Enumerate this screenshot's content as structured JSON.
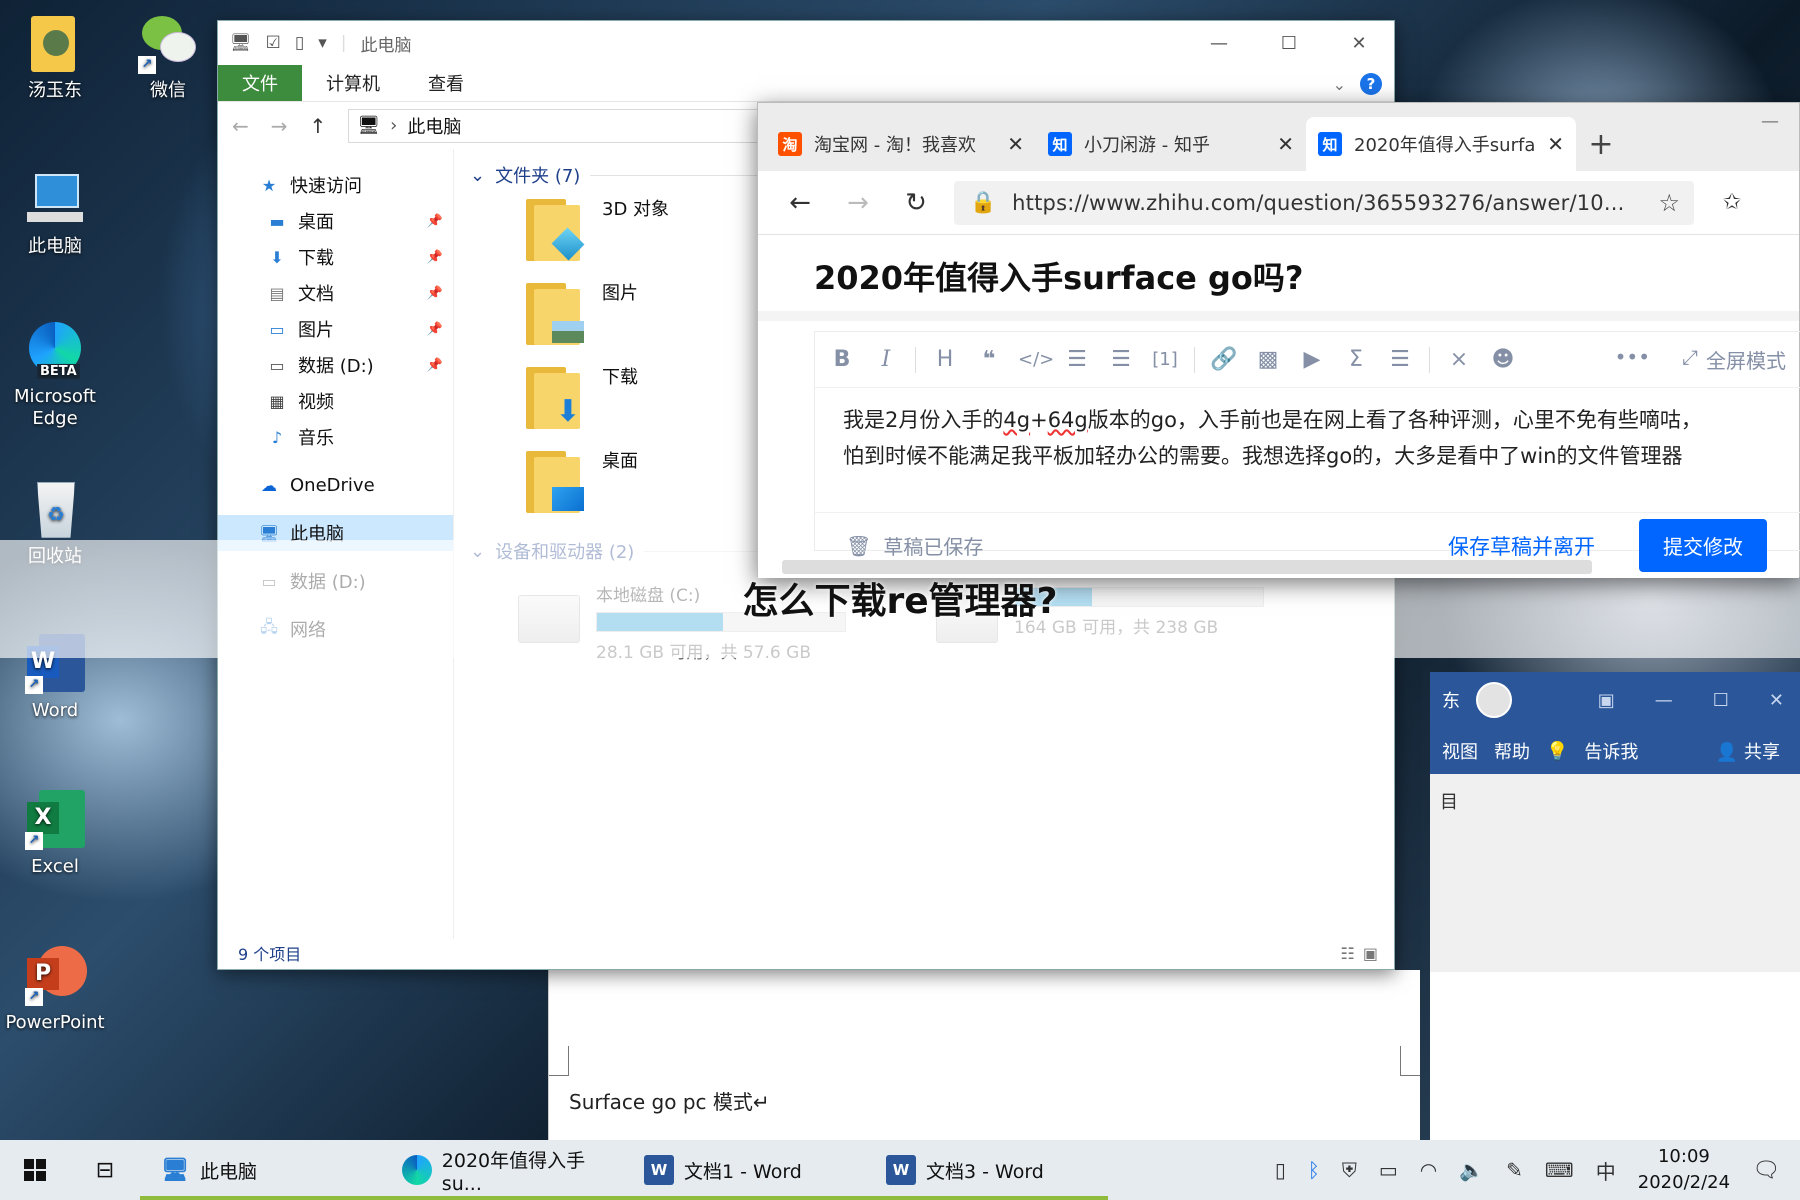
{
  "desktop": {
    "icons": [
      {
        "label": "汤玉东"
      },
      {
        "label": "微信"
      },
      {
        "label": "此电脑"
      },
      {
        "label": "Microsoft Edge"
      },
      {
        "label": "回收站"
      },
      {
        "label": "Word"
      },
      {
        "label": "Excel"
      },
      {
        "label": "PowerPoint"
      }
    ],
    "edge_badge": "BETA"
  },
  "explorer": {
    "title": "此电脑",
    "ribbon_tabs": [
      "文件",
      "计算机",
      "查看"
    ],
    "address": "此电脑",
    "nav": {
      "quick_access": "快速访问",
      "items": [
        "桌面",
        "下载",
        "文档",
        "图片",
        "数据 (D:)",
        "视频",
        "音乐"
      ],
      "onedrive": "OneDrive",
      "this_pc": "此电脑",
      "data_d": "数据 (D:)",
      "network": "网络"
    },
    "folders_header": "文件夹 (7)",
    "folders": [
      "3D 对象",
      "图片",
      "下载",
      "桌面"
    ],
    "devices_header": "设备和驱动器 (2)",
    "drives": [
      {
        "name": "本地磁盘 (C:)",
        "free": "28.1 GB 可用，共 57.6 GB",
        "used_fraction": 0.51
      },
      {
        "name": "",
        "free": "164 GB 可用，共 238 GB",
        "used_fraction": 0.31
      }
    ],
    "status": "9 个项目"
  },
  "edge": {
    "tabs": [
      {
        "fav": "淘",
        "title": "淘宝网 - 淘！我喜欢"
      },
      {
        "fav": "知",
        "title": "小刀闲游 - 知乎"
      },
      {
        "fav": "知",
        "title": "2020年值得入手surfac"
      }
    ],
    "url": "https://www.zhihu.com/question/365593276/answer/10...",
    "question_title": "2020年值得入手surface go吗?",
    "toolbar_fullscreen": "全屏模式",
    "editor_line1_a": "我是2月份入手的",
    "editor_line1_ul1": "4g",
    "editor_line1_b": "+",
    "editor_line1_ul2": "64g",
    "editor_line1_c": "版本的go，入手前也是在网上看了各种评测，心里不免有些嘀咕，",
    "editor_line2": "怕到时候不能满足我平板加轻办公的需要。我想选择go的，大多是看中了win的文件管理器",
    "draft_saved": "草稿已保存",
    "save_leave": "保存草稿并离开",
    "submit": "提交修改"
  },
  "overlay_title": "怎么下载re管理器?",
  "word": {
    "doc_line": "Surface go pc  模式↵",
    "title_fragment": "东",
    "ribbon_items": [
      "视图",
      "帮助",
      "告诉我",
      "共享"
    ],
    "side_fragment": "目"
  },
  "taskbar": {
    "apps": [
      {
        "label": "此电脑"
      },
      {
        "label": "2020年值得入手su..."
      },
      {
        "label": "文档1 - Word"
      },
      {
        "label": "文档3 - Word"
      }
    ],
    "ime": "中",
    "time": "10:09",
    "date": "2020/2/24"
  }
}
